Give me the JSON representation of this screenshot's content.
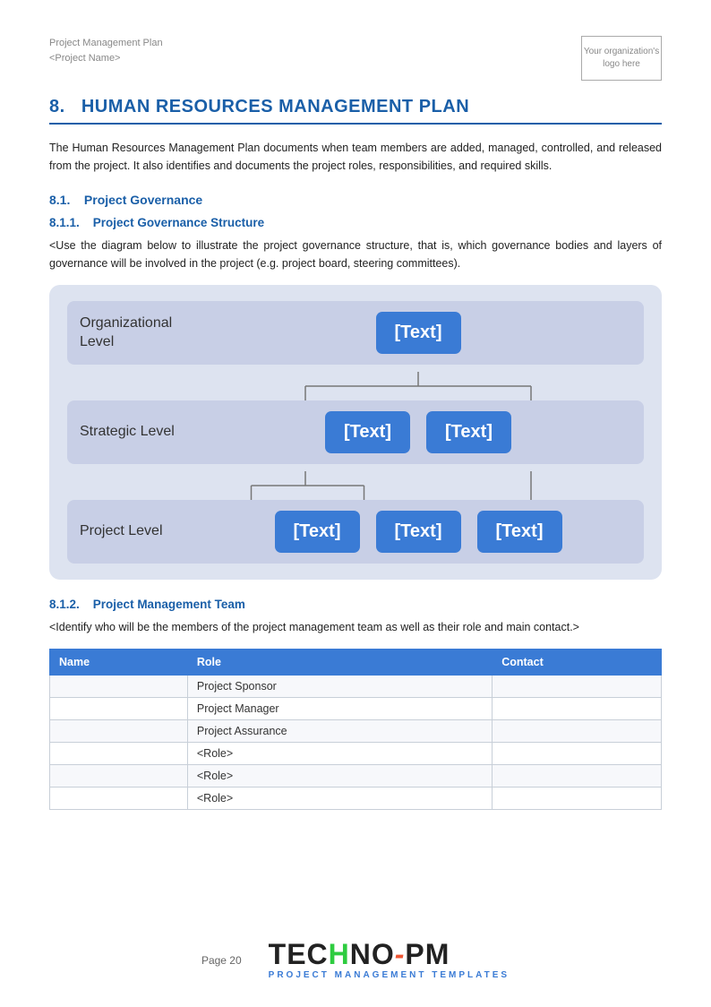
{
  "header": {
    "line1": "Project Management Plan",
    "line2": "<Project Name>",
    "logo_text": "Your organization's logo here"
  },
  "section": {
    "number": "8.",
    "title": "HUMAN RESOURCES MANAGEMENT PLAN"
  },
  "intro_text": "The Human Resources Management Plan documents when team members are added, managed, controlled, and released from the project. It also identifies and documents the project roles, responsibilities, and required skills.",
  "subsections": {
    "s81": {
      "label": "8.1.",
      "title": "Project Governance"
    },
    "s811": {
      "label": "8.1.1.",
      "title": "Project Governance Structure"
    },
    "s812": {
      "label": "8.1.2.",
      "title": "Project Management Team"
    }
  },
  "governance_desc": "<Use the diagram below to illustrate the project governance structure, that is, which governance bodies and layers of governance will be involved in the project (e.g. project board, steering committees).",
  "team_desc": "<Identify who will be the members of the project management team as well as their role and main contact.>",
  "diagram": {
    "levels": [
      {
        "name": "Organizational\nLevel",
        "nodes": [
          "[Text]"
        ]
      },
      {
        "name": "Strategic Level",
        "nodes": [
          "[Text]",
          "[Text]"
        ]
      },
      {
        "name": "Project Level",
        "nodes": [
          "[Text]",
          "[Text]",
          "[Text]"
        ]
      }
    ]
  },
  "table": {
    "headers": [
      "Name",
      "Role",
      "Contact"
    ],
    "rows": [
      {
        "name": "",
        "role": "Project Sponsor",
        "contact": ""
      },
      {
        "name": "",
        "role": "Project Manager",
        "contact": ""
      },
      {
        "name": "",
        "role": "Project Assurance",
        "contact": ""
      },
      {
        "name": "",
        "role": "<Role>",
        "contact": ""
      },
      {
        "name": "",
        "role": "<Role>",
        "contact": ""
      },
      {
        "name": "",
        "role": "<Role>",
        "contact": ""
      }
    ]
  },
  "footer": {
    "page_label": "Page 20",
    "brand_name": "TECHNO-PM",
    "brand_tagline": "PROJECT MANAGEMENT TEMPLATES"
  }
}
